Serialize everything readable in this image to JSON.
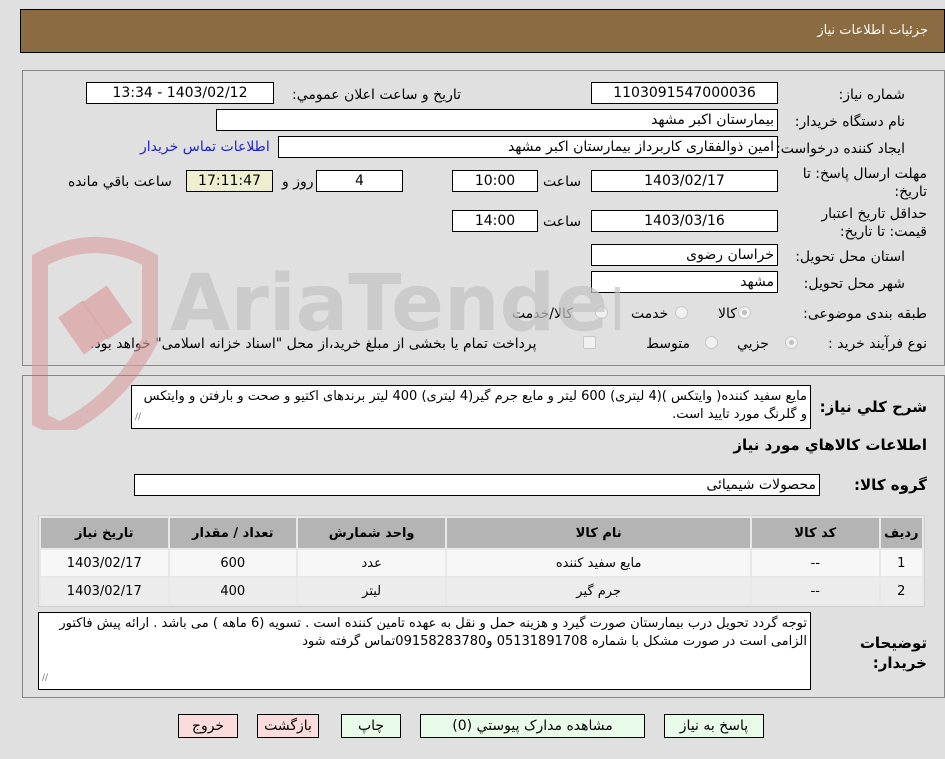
{
  "header": {
    "title": "جزئيات اطلاعات نياز"
  },
  "form": {
    "need_number_label": "شماره نیاز:",
    "need_number": "1103091547000036",
    "announce_label": "تاريخ و ساعت اعلان عمومي:",
    "announce_value": "1403/02/12 - 13:34",
    "buyer_org_label": "نام دستگاه خریدار:",
    "buyer_org": "بیمارستان اکبر مشهد",
    "creator_label": "ایجاد کننده درخواست:",
    "creator": "امین ذوالفقاری کاربرداز بیمارستان اکبر مشهد",
    "contact_link": "اطلاعات تماس خریدار",
    "reply_deadline_label": "مهلت ارسال پاسخ: تا تاریخ:",
    "reply_date": "1403/02/17",
    "time_label": "ساعت",
    "reply_time": "10:00",
    "days_remaining": "4",
    "days_label": "روز و",
    "time_remaining": "17:11:47",
    "remaining_label": "ساعت باقي مانده",
    "price_validity_label": "حداقل تاریخ اعتبار قیمت: تا تاریخ:",
    "price_validity_date": "1403/03/16",
    "price_validity_time": "14:00",
    "province_label": "استان محل تحویل:",
    "province": "خراسان رضوی",
    "city_label": "شهر محل تحویل:",
    "city": "مشهد",
    "category_label": "طبقه بندی موضوعی:",
    "category_options": [
      "کالا",
      "خدمت",
      "کالا/خدمت"
    ],
    "category_selected": "کالا",
    "process_label": "نوع فرآیند خرید :",
    "process_options": [
      "جزيي",
      "متوسط"
    ],
    "process_selected": "جزيي",
    "treasury_note": "پرداخت تمام یا بخشی از مبلغ خرید،از محل \"اسناد خزانه اسلامی\" خواهد بود."
  },
  "details": {
    "summary_label": "شرح كلي نياز:",
    "summary": "مایع سفید کننده( وایتکس )(4 لیتری) 600 لیتر و مایع جرم گیر(4 لیتری) 400 لیتر برندهای اکتیو و صحت و بارفتن و وایتکس و گلرنگ مورد تایید است.",
    "goods_info_title": "اطلاعات كالاهاي مورد نياز",
    "goods_group_label": "گروه کالا:",
    "goods_group": "محصولات شیمیائی",
    "table": {
      "headers": [
        "رديف",
        "كد كالا",
        "نام كالا",
        "واحد شمارش",
        "تعداد / مقدار",
        "تاريخ نياز"
      ],
      "rows": [
        [
          "1",
          "--",
          "مایع سفید کننده",
          "عدد",
          "600",
          "1403/02/17"
        ],
        [
          "2",
          "--",
          "جرم گیر",
          "لیتر",
          "400",
          "1403/02/17"
        ]
      ]
    },
    "buyer_notes_label": "توضيحات خريدار:",
    "buyer_notes": "توجه گردد تحویل درب بیمارستان صورت گیرد و هزینه حمل و نقل به عهده تامین کننده است . تسویه (6 ماهه ) می باشد . ارائه پیش فاکتور الزامی است در صورت مشکل با شماره 05131891708  و09158283780تماس گرفته شود"
  },
  "buttons": {
    "reply": "پاسخ به نياز",
    "attachments": "مشاهده مدارک پيوستي (0)",
    "print": "چاپ",
    "back": "بازگشت",
    "exit": "خروج"
  },
  "watermark": {
    "text": "AriaTender.neT"
  },
  "colors": {
    "header": "#8b6c42",
    "link": "#2222cc",
    "timer": "#efefcf",
    "green_btn": "#e9fbe9",
    "red_btn": "#fbdcdc"
  }
}
